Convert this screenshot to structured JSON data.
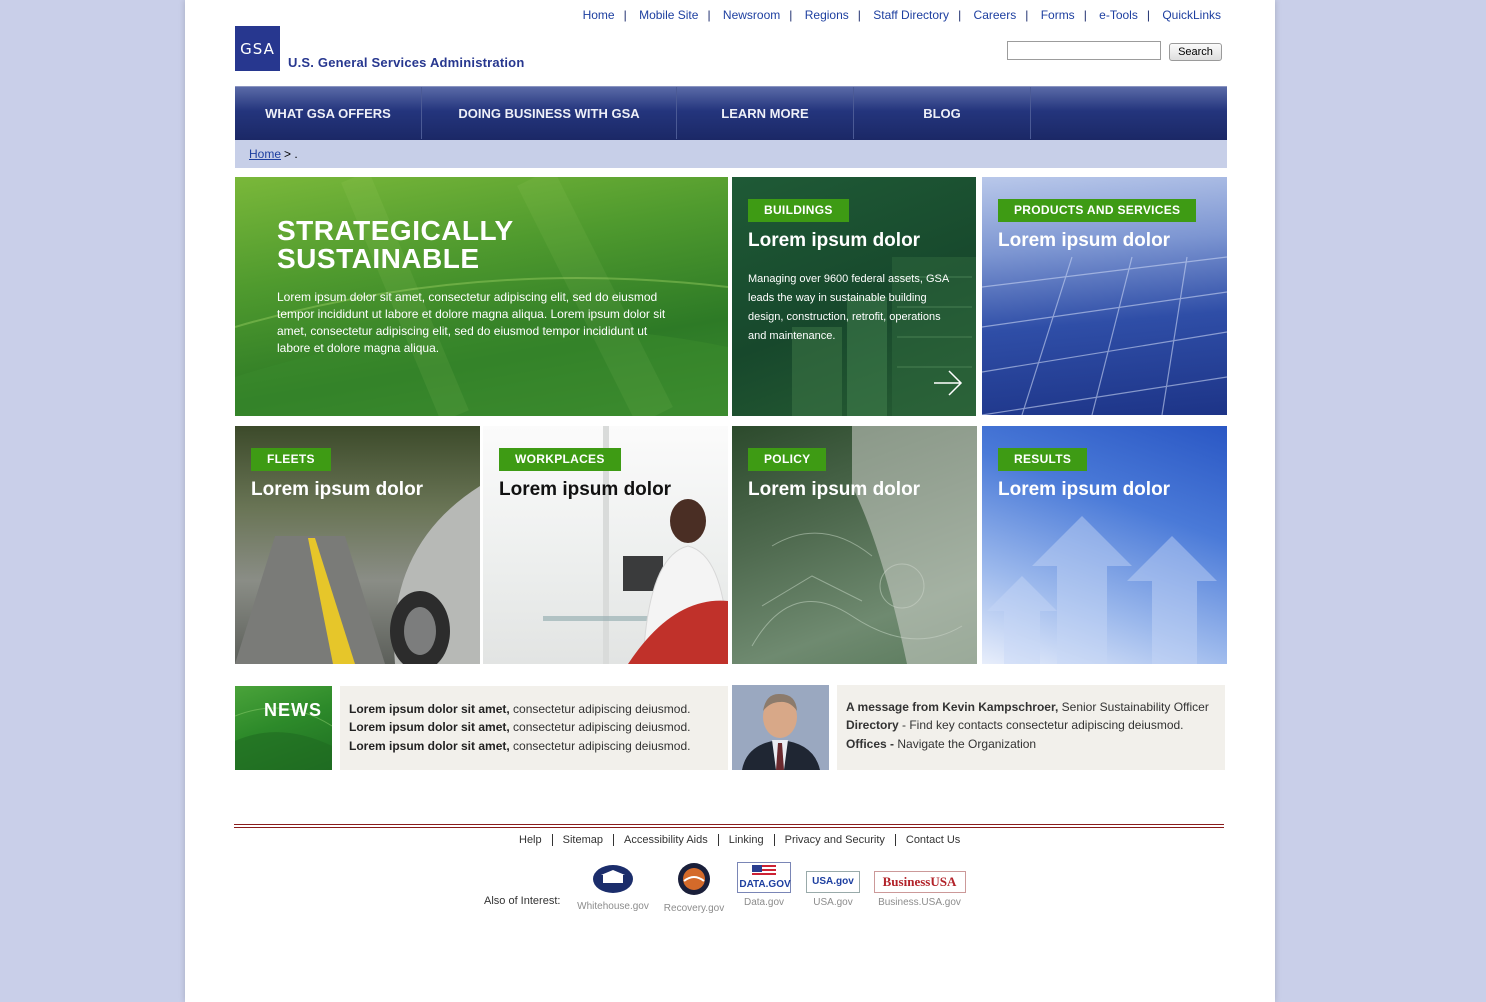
{
  "utility_nav": [
    "Home",
    "Mobile Site",
    "Newsroom",
    "Regions",
    "Staff Directory",
    "Careers",
    "Forms",
    "e-Tools",
    "QuickLinks"
  ],
  "brand": {
    "logo_mark": "GSA",
    "name": "U.S. General Services Administration"
  },
  "search": {
    "button_label": "Search",
    "value": ""
  },
  "main_nav": [
    "WHAT GSA OFFERS",
    "DOING BUSINESS WITH GSA",
    "LEARN MORE",
    "BLOG"
  ],
  "breadcrumb": {
    "home": "Home",
    "sep": "> ."
  },
  "hero": {
    "headline_1": "STRATEGICALLY",
    "headline_2": "SUSTAINABLE",
    "body": "Lorem ipsum dolor sit amet, consectetur adipiscing elit, sed do eiusmod tempor incididunt ut labore et dolore magna aliqua. Lorem ipsum dolor sit amet, consectetur adipiscing elit, sed do eiusmod tempor incididunt ut labore et dolore magna aliqua."
  },
  "tiles": [
    {
      "tag": "BUILDINGS",
      "title": "Lorem ipsum dolor",
      "desc": "Managing over 9600 federal assets, GSA leads the way in sustainable building design, construction, retrofit, operations and maintenance.",
      "icon": "arrow-right-icon"
    },
    {
      "tag": "PRODUCTS AND SERVICES",
      "title": "Lorem ipsum dolor"
    },
    {
      "tag": "FLEETS",
      "title": "Lorem ipsum dolor"
    },
    {
      "tag": "WORKPLACES",
      "title": "Lorem ipsum dolor"
    },
    {
      "tag": "POLICY",
      "title": "Lorem ipsum dolor"
    },
    {
      "tag": "RESULTS",
      "title": "Lorem ipsum dolor"
    }
  ],
  "news": {
    "label": "NEWS",
    "items": [
      {
        "bold": "Lorem ipsum dolor sit amet,",
        "rest": " consectetur adipiscing deiusmod."
      },
      {
        "bold": "Lorem ipsum dolor sit amet,",
        "rest": " consectetur adipiscing deiusmod."
      },
      {
        "bold": "Lorem ipsum dolor sit amet,",
        "rest": " consectetur adipiscing deiusmod."
      }
    ]
  },
  "message": {
    "line1_bold": "A message from Kevin Kampschroer,",
    "line1_rest": " Senior Sustainability Officer",
    "line2_bold": "Directory",
    "line2_rest": "  - Find key contacts consectetur adipiscing deiusmod.",
    "line3_bold": "Offices -",
    "line3_rest": " Navigate the Organization"
  },
  "footer": {
    "links": [
      "Help",
      "Sitemap",
      "Accessibility Aids",
      "Linking",
      "Privacy and Security",
      "Contact Us"
    ],
    "also_label": "Also of Interest:",
    "partners": [
      {
        "caption": "Whitehouse.gov",
        "logo": "whitehouse-seal-icon"
      },
      {
        "caption": "Recovery.gov",
        "logo": "recovery-seal-icon"
      },
      {
        "caption": "Data.gov",
        "logo_text": "DATA.GOV"
      },
      {
        "caption": "USA.gov",
        "logo_text": "USA.gov"
      },
      {
        "caption": "Business.USA.gov",
        "logo_text": "BusinessUSA"
      }
    ]
  },
  "colors": {
    "nav_blue": "#24357d",
    "tag_green": "#3e9b14",
    "link_blue": "#1d3fa0",
    "page_bg": "#c9cfe9",
    "footer_rule": "#8a1c1c"
  }
}
